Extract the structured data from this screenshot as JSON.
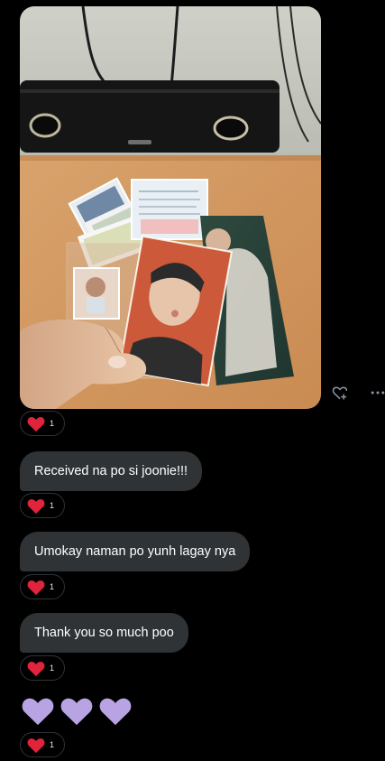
{
  "photo_message": {
    "desk_note_text": "Thank you so much for purchasing"
  },
  "reaction": {
    "emoji": "red-heart",
    "count": "1",
    "color": "#f91880"
  },
  "messages": [
    {
      "text": "Received na po si joonie!!!"
    },
    {
      "text": "Umokay naman po yunh lagay nya"
    },
    {
      "text": "Thank you so much poo"
    }
  ],
  "hearts_message": {
    "count": 3,
    "color": "#b8a4e3"
  },
  "colors": {
    "bubble": "#2f3336",
    "background": "#000000"
  },
  "icons": [
    "heart-plus-icon",
    "more-icon",
    "red-heart-icon",
    "purple-heart-icon"
  ]
}
